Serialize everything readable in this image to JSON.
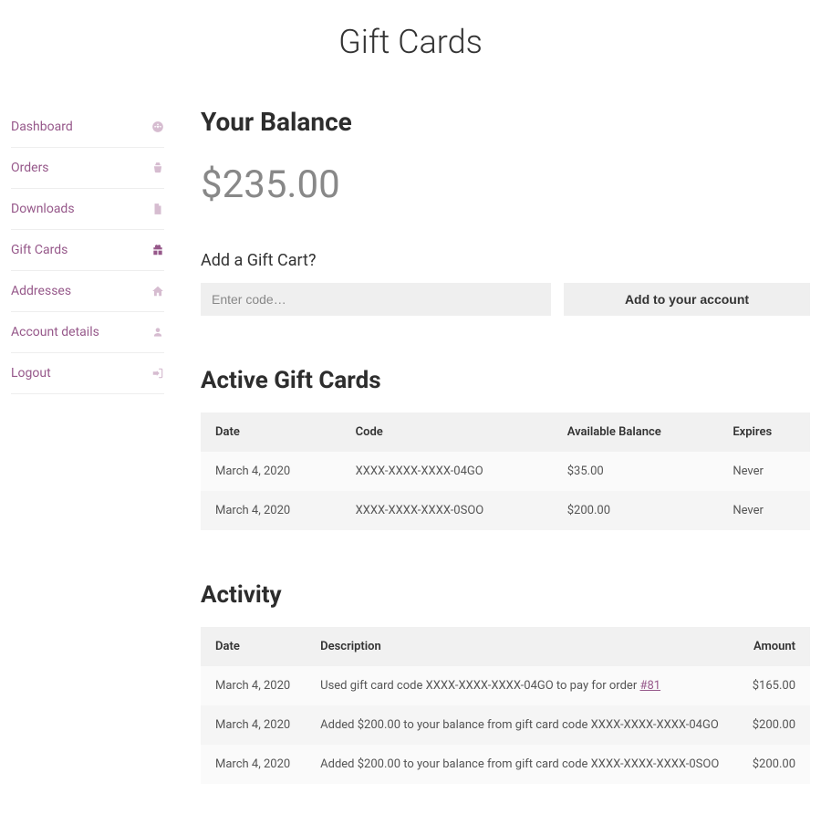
{
  "pageTitle": "Gift Cards",
  "sidebar": {
    "items": [
      {
        "label": "Dashboard",
        "name": "sidebar-item-dashboard",
        "icon": "dashboard-icon",
        "active": false
      },
      {
        "label": "Orders",
        "name": "sidebar-item-orders",
        "icon": "basket-icon",
        "active": false
      },
      {
        "label": "Downloads",
        "name": "sidebar-item-downloads",
        "icon": "file-icon",
        "active": false
      },
      {
        "label": "Gift Cards",
        "name": "sidebar-item-giftcards",
        "icon": "gift-icon",
        "active": true
      },
      {
        "label": "Addresses",
        "name": "sidebar-item-addresses",
        "icon": "home-icon",
        "active": false
      },
      {
        "label": "Account details",
        "name": "sidebar-item-account",
        "icon": "user-icon",
        "active": false
      },
      {
        "label": "Logout",
        "name": "sidebar-item-logout",
        "icon": "logout-icon",
        "active": false
      }
    ]
  },
  "balance": {
    "heading": "Your Balance",
    "value": "$235.00"
  },
  "addCard": {
    "heading": "Add a Gift Cart?",
    "placeholder": "Enter code…",
    "button": "Add to your account"
  },
  "activeCards": {
    "heading": "Active Gift Cards",
    "columns": {
      "date": "Date",
      "code": "Code",
      "available": "Available Balance",
      "expires": "Expires"
    },
    "rows": [
      {
        "date": "March 4, 2020",
        "code": "XXXX-XXXX-XXXX-04GO",
        "available": "$35.00",
        "expires": "Never"
      },
      {
        "date": "March 4, 2020",
        "code": "XXXX-XXXX-XXXX-0SOO",
        "available": "$200.00",
        "expires": "Never"
      }
    ]
  },
  "activity": {
    "heading": "Activity",
    "columns": {
      "date": "Date",
      "description": "Description",
      "amount": "Amount"
    },
    "rows": [
      {
        "date": "March 4, 2020",
        "descPrefix": "Used gift card code XXXX-XXXX-XXXX-04GO to pay for order ",
        "orderLink": "#81",
        "descSuffix": "",
        "amount": "$165.00"
      },
      {
        "date": "March 4, 2020",
        "descPrefix": "Added $200.00 to your balance from gift card code XXXX-XXXX-XXXX-04GO",
        "orderLink": "",
        "descSuffix": "",
        "amount": "$200.00"
      },
      {
        "date": "March 4, 2020",
        "descPrefix": "Added $200.00 to your balance from gift card code XXXX-XXXX-XXXX-0SOO",
        "orderLink": "",
        "descSuffix": "",
        "amount": "$200.00"
      }
    ]
  }
}
